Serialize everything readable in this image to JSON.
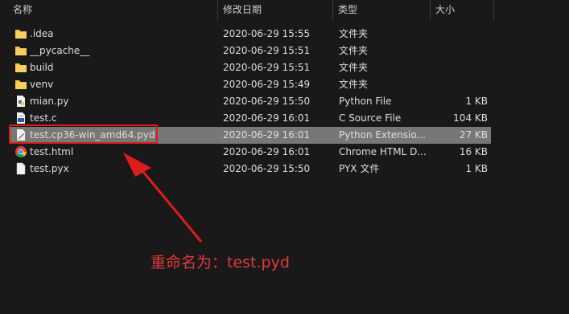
{
  "columns": {
    "name": "名称",
    "date": "修改日期",
    "type": "类型",
    "size": "大小"
  },
  "files": [
    {
      "name": ".idea",
      "date": "2020-06-29 15:55",
      "type": "文件夹",
      "size": "",
      "icon": "folder-icon"
    },
    {
      "name": "__pycache__",
      "date": "2020-06-29 15:51",
      "type": "文件夹",
      "size": "",
      "icon": "folder-icon"
    },
    {
      "name": "build",
      "date": "2020-06-29 15:51",
      "type": "文件夹",
      "size": "",
      "icon": "folder-icon"
    },
    {
      "name": "venv",
      "date": "2020-06-29 15:49",
      "type": "文件夹",
      "size": "",
      "icon": "folder-icon"
    },
    {
      "name": "mian.py",
      "date": "2020-06-29 15:50",
      "type": "Python File",
      "size": "1 KB",
      "icon": "python-file-icon"
    },
    {
      "name": "test.c",
      "date": "2020-06-29 16:01",
      "type": "C Source File",
      "size": "104 KB",
      "icon": "c-source-file-icon"
    },
    {
      "name": "test.cp36-win_amd64.pyd",
      "date": "2020-06-29 16:01",
      "type": "Python Extensio...",
      "size": "27 KB",
      "icon": "python-extension-file-icon",
      "selected": true
    },
    {
      "name": "test.html",
      "date": "2020-06-29 16:01",
      "type": "Chrome HTML D...",
      "size": "16 KB",
      "icon": "chrome-html-icon"
    },
    {
      "name": "test.pyx",
      "date": "2020-06-29 15:50",
      "type": "PYX 文件",
      "size": "1 KB",
      "icon": "blank-file-icon"
    }
  ],
  "annotation": {
    "text": "重命名为：test.pyd",
    "color": "#e01b1b"
  },
  "colors": {
    "background": "#191919",
    "selected_row": "#777777",
    "annotation_red": "#e01b1b",
    "folder_yellow": "#f3c24a"
  }
}
